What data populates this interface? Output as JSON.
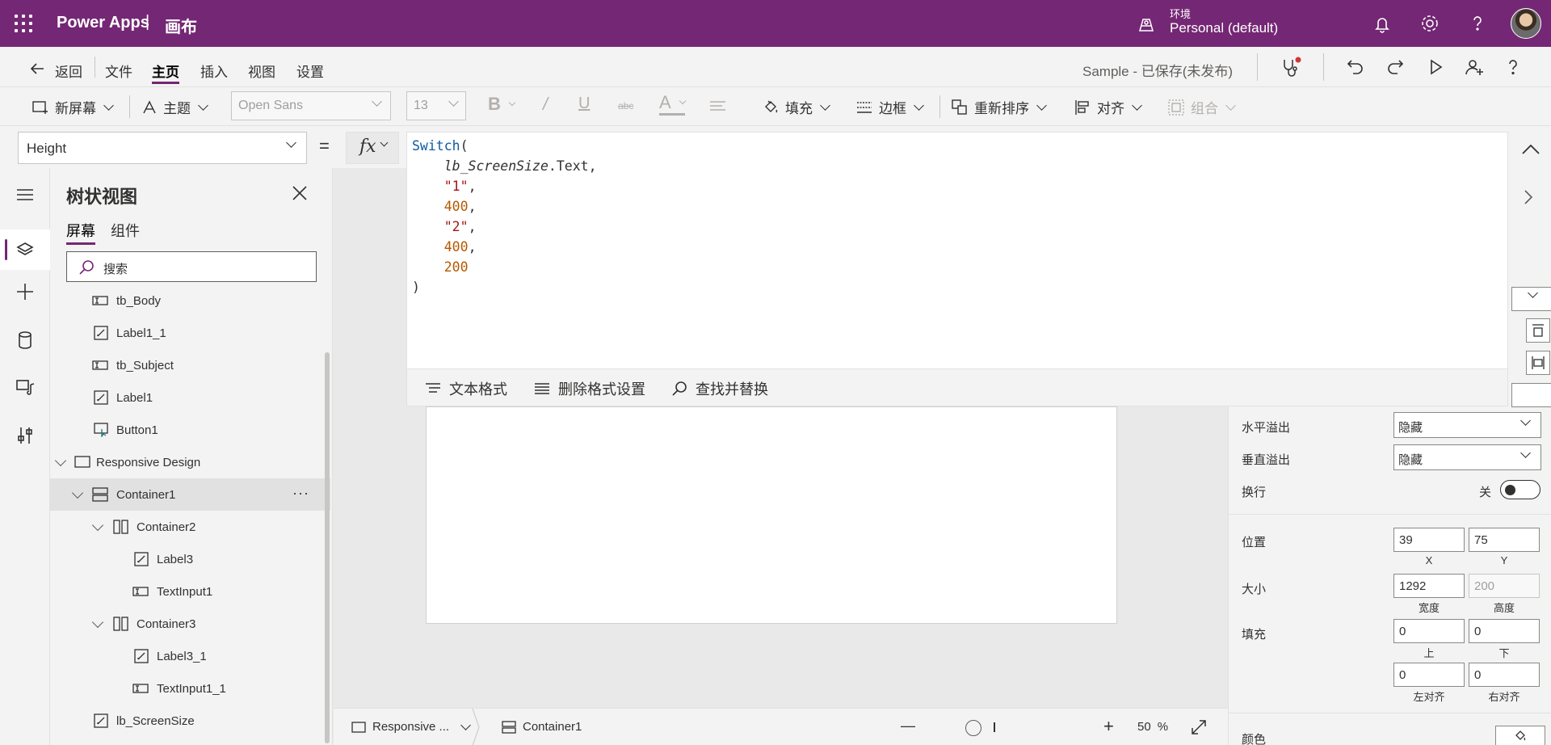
{
  "topbar": {
    "brand": "Power Apps",
    "separator": "|",
    "app_kind": "画布",
    "env_label": "环境",
    "env_value": "Personal (default)"
  },
  "ribbon_tabs": {
    "back": "返回",
    "file": "文件",
    "home": "主页",
    "insert": "插入",
    "view": "视图",
    "settings": "设置",
    "status": "Sample - 已保存(未发布)"
  },
  "toolbar": {
    "new_screen": "新屏幕",
    "theme": "主题",
    "font": "Open Sans",
    "font_size": "13",
    "fill": "填充",
    "border": "边框",
    "reorder": "重新排序",
    "align": "对齐",
    "group": "组合"
  },
  "formula_bar": {
    "property": "Height",
    "equals": "=",
    "fx": "fx",
    "code": {
      "fn": "Switch",
      "id": "lb_ScreenSize",
      "member": ".Text",
      "s1": "\"1\"",
      "n1": "400",
      "s2": "\"2\"",
      "n2": "400",
      "n3": "200"
    },
    "footer": {
      "format_text": "文本格式",
      "remove_format": "删除格式设置",
      "find_replace": "查找并替换"
    }
  },
  "tree": {
    "title": "树状视图",
    "tab_screens": "屏幕",
    "tab_components": "组件",
    "search_placeholder": "搜索",
    "items": [
      {
        "label": "tb_Body"
      },
      {
        "label": "Label1_1"
      },
      {
        "label": "tb_Subject"
      },
      {
        "label": "Label1"
      },
      {
        "label": "Button1"
      },
      {
        "label": "Responsive Design"
      },
      {
        "label": "Container1"
      },
      {
        "label": "Container2"
      },
      {
        "label": "Label3"
      },
      {
        "label": "TextInput1"
      },
      {
        "label": "Container3"
      },
      {
        "label": "Label3_1"
      },
      {
        "label": "TextInput1_1"
      },
      {
        "label": "lb_ScreenSize"
      }
    ],
    "more": "···"
  },
  "bottombar": {
    "screen": "Responsive ...",
    "control": "Container1",
    "zoom_minus": "—",
    "zoom_plus": "+",
    "zoom_value": "50",
    "zoom_unit": "%"
  },
  "props": {
    "h_overflow_label": "水平溢出",
    "h_overflow_value": "隐藏",
    "v_overflow_label": "垂直溢出",
    "v_overflow_value": "隐藏",
    "wrap_label": "换行",
    "wrap_state": "关",
    "position_label": "位置",
    "pos_x": "39",
    "pos_y": "75",
    "cap_x": "X",
    "cap_y": "Y",
    "size_label": "大小",
    "width": "1292",
    "height": "200",
    "cap_width": "宽度",
    "cap_height": "高度",
    "padding_label": "填充",
    "pad_top": "0",
    "pad_bottom": "0",
    "cap_top": "上",
    "cap_bottom": "下",
    "pad_left": "0",
    "pad_right": "0",
    "cap_left": "左对齐",
    "cap_right": "右对齐",
    "color_label": "颜色"
  },
  "colors": {
    "brand": "#742774",
    "selected_row": "#e1e1e1"
  }
}
